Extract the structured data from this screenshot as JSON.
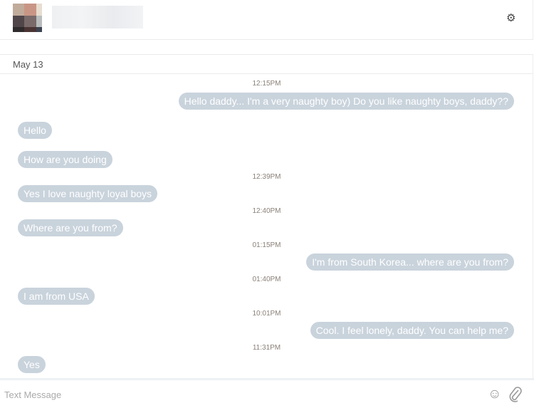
{
  "header": {
    "settings_icon": "gear-icon"
  },
  "date_label": "May 13",
  "messages": [
    {
      "time": "12:15PM",
      "side": "out",
      "text": "Hello daddy... I'm a very naughty boy) Do you like naughty boys, daddy??"
    },
    {
      "side": "in",
      "text": "Hello"
    },
    {
      "side": "in",
      "text": "How are you doing"
    },
    {
      "time": "12:39PM",
      "side": "in",
      "text": "Yes I love naughty loyal boys"
    },
    {
      "time": "12:40PM",
      "side": "in",
      "text": "Where are you from?"
    },
    {
      "time": "01:15PM",
      "side": "out",
      "text": "I'm from South Korea... where are you from?"
    },
    {
      "time": "01:40PM",
      "side": "in",
      "text": "I am from USA"
    },
    {
      "time": "10:01PM",
      "side": "out",
      "text": "Cool. I feel lonely, daddy. You can help me?"
    },
    {
      "time": "11:31PM",
      "side": "in",
      "text": "Yes"
    }
  ],
  "composer": {
    "placeholder": "Text Message",
    "emoji_icon": "smiley-icon",
    "attach_icon": "paperclip-icon"
  },
  "colors": {
    "bubble": "#c9d3dc",
    "bubble_text": "#ffffff"
  }
}
